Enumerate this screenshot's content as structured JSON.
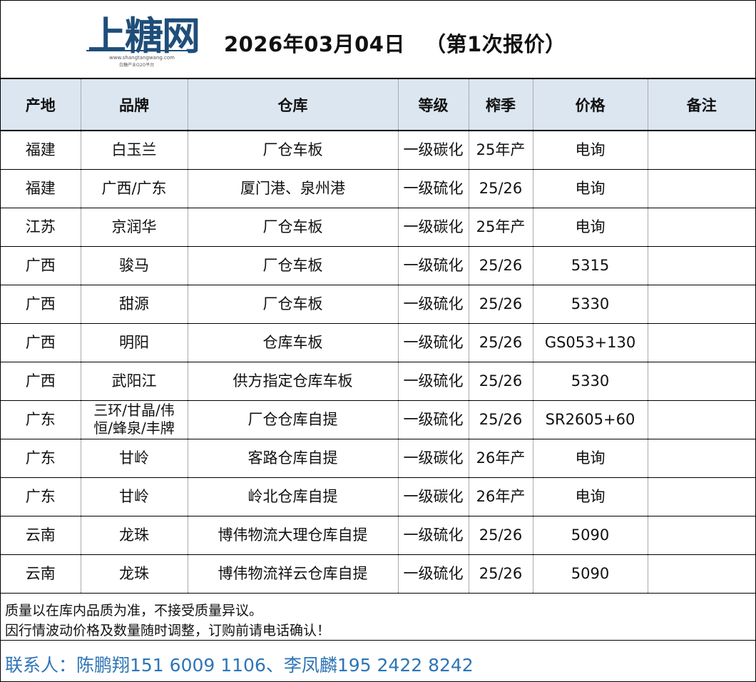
{
  "logo": {
    "main": "上糖网",
    "sub": "www.shangtangwang.com",
    "tagline": "白糖产业O2O平台"
  },
  "title": {
    "date": "2026年03月04日",
    "round": "（第1次报价）"
  },
  "header": [
    "产地",
    "品牌",
    "仓库",
    "等级",
    "榨季",
    "价格",
    "备注"
  ],
  "rows": [
    [
      "福建",
      "白玉兰",
      "厂仓车板",
      "一级碳化",
      "25年产",
      "电询",
      ""
    ],
    [
      "福建",
      "广西/广东",
      "厦门港、泉州港",
      "一级硫化",
      "25/26",
      "电询",
      ""
    ],
    [
      "江苏",
      "京润华",
      "厂仓车板",
      "一级碳化",
      "25年产",
      "电询",
      ""
    ],
    [
      "广西",
      "骏马",
      "厂仓车板",
      "一级硫化",
      "25/26",
      "5315",
      ""
    ],
    [
      "广西",
      "甜源",
      "厂仓车板",
      "一级硫化",
      "25/26",
      "5330",
      ""
    ],
    [
      "广西",
      "明阳",
      "仓库车板",
      "一级硫化",
      "25/26",
      "GS053+130",
      ""
    ],
    [
      "广西",
      "武阳江",
      "供方指定仓库车板",
      "一级硫化",
      "25/26",
      "5330",
      ""
    ],
    [
      "广东",
      "三环/甘晶/伟恒/蜂泉/丰牌",
      "厂仓仓库自提",
      "一级硫化",
      "25/26",
      "SR2605+60",
      ""
    ],
    [
      "广东",
      "甘岭",
      "客路仓库自提",
      "一级碳化",
      "26年产",
      "电询",
      ""
    ],
    [
      "广东",
      "甘岭",
      "岭北仓库自提",
      "一级碳化",
      "26年产",
      "电询",
      ""
    ],
    [
      "云南",
      "龙珠",
      "博伟物流大理仓库自提",
      "一级硫化",
      "25/26",
      "5090",
      ""
    ],
    [
      "云南",
      "龙珠",
      "博伟物流祥云仓库自提",
      "一级硫化",
      "25/26",
      "5090",
      ""
    ]
  ],
  "notes": [
    "质量以在库内品质为准，不接受质量异议。",
    "因行情波动价格及数量随时调整，订购前请电话确认！"
  ],
  "contact": "联系人：陈鹏翔151 6009 1106、李凤麟195 2422 8242",
  "colors": {
    "header_bg": "#dce6f1",
    "logo_blue": "#1f4e79",
    "contact_blue": "#2e75b6"
  }
}
